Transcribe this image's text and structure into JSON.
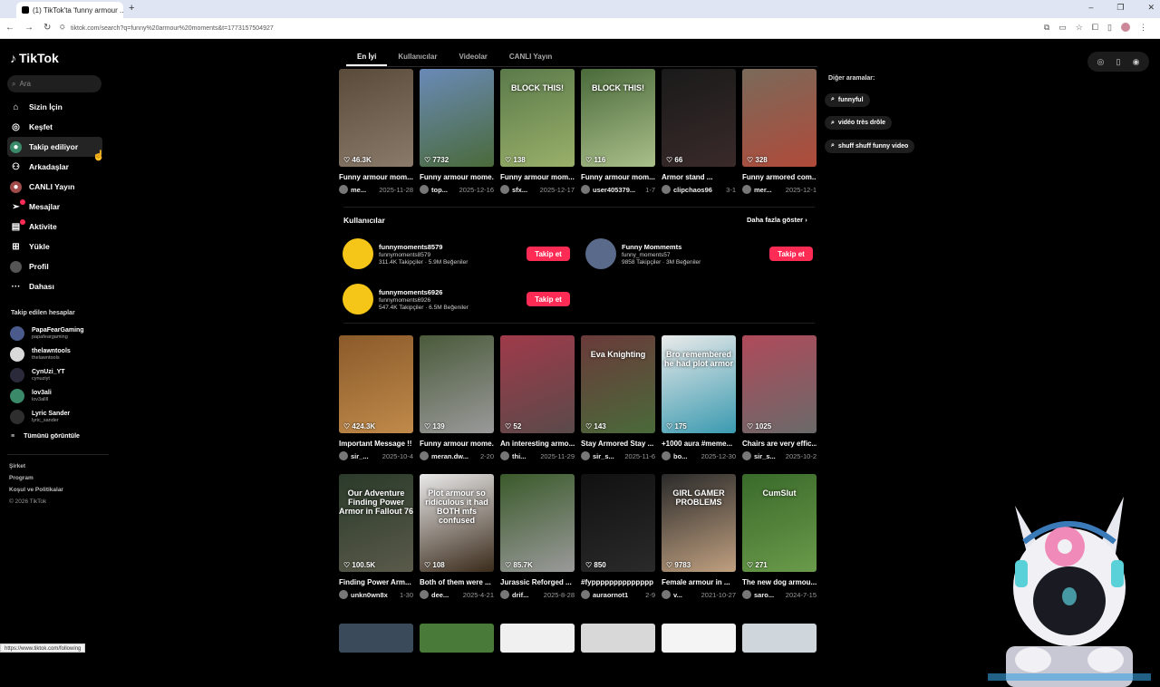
{
  "browser": {
    "tab_title": "(1) TikTok'ta 'funny armour ...",
    "tab_close": "✕",
    "url": "tiktok.com/search?q=funny%20armour%20moments&t=1773157504927",
    "status_url": "https://www.tiktok.com/following"
  },
  "brand": {
    "name": "TikTok"
  },
  "search": {
    "placeholder": "Ara"
  },
  "nav": [
    {
      "label": "Sizin İçin",
      "icon": "home-icon"
    },
    {
      "label": "Keşfet",
      "icon": "compass-icon"
    },
    {
      "label": "Takip ediliyor",
      "icon": "following-icon"
    },
    {
      "label": "Arkadaşlar",
      "icon": "friends-icon"
    },
    {
      "label": "CANLI Yayın",
      "icon": "live-icon"
    },
    {
      "label": "Mesajlar",
      "icon": "messages-icon"
    },
    {
      "label": "Aktivite",
      "icon": "activity-icon"
    },
    {
      "label": "Yükle",
      "icon": "upload-icon"
    },
    {
      "label": "Profil",
      "icon": "profile-icon"
    },
    {
      "label": "Dahası",
      "icon": "more-icon"
    }
  ],
  "following": {
    "title": "Takip edilen hesaplar",
    "accounts": [
      {
        "name": "PapaFearGaming",
        "handle": "papafeargaming",
        "color": "#4a5a8a"
      },
      {
        "name": "thelawntools",
        "handle": "thelawntools",
        "color": "#d9d9d9"
      },
      {
        "name": "CynUzi_YT",
        "handle": "cynuziyt",
        "color": "#2a2a3a"
      },
      {
        "name": "lov3ali",
        "handle": "lov3allll",
        "color": "#3a8a6a"
      },
      {
        "name": "Lyric Sander",
        "handle": "lyric_sander",
        "color": "#2e2e2e"
      }
    ],
    "see_all": "Tümünü görüntüle"
  },
  "footer": [
    "Şirket",
    "Program",
    "Koşul ve Politikalar",
    "© 2026 TikTok"
  ],
  "tabs": [
    "En İyi",
    "Kullanıcılar",
    "Videolar",
    "CANLI Yayın"
  ],
  "row1": [
    {
      "likes": "46.3K",
      "title": "Funny armour mom...",
      "user": "me...",
      "date": "2025-11-28",
      "c1": "#5a4a3a",
      "c2": "#8a7a6a",
      "overlay": ""
    },
    {
      "likes": "7732",
      "title": "Funny armour mome...",
      "user": "top...",
      "date": "2025-12-16",
      "c1": "#6a8ab8",
      "c2": "#4a6a3a",
      "overlay": ""
    },
    {
      "likes": "138",
      "title": "Funny armour mom...",
      "user": "sfx...",
      "date": "2025-12-17",
      "c1": "#5a7a4a",
      "c2": "#9ab06a",
      "overlay": "BLOCK THIS!"
    },
    {
      "likes": "116",
      "title": "Funny armour mom...",
      "user": "user405379...",
      "date": "1-7",
      "c1": "#4a6a3a",
      "c2": "#aabf8a",
      "overlay": "BLOCK THIS!"
    },
    {
      "likes": "66",
      "title": "Armor stand ...",
      "user": "clipchaos96",
      "date": "3-1",
      "c1": "#1a1a1a",
      "c2": "#3a2a2a",
      "overlay": ""
    },
    {
      "likes": "328",
      "title": "Funny armored com...",
      "user": "mer...",
      "date": "2025-12-1",
      "c1": "#7a6a5a",
      "c2": "#b04a3a",
      "overlay": ""
    }
  ],
  "users_section": {
    "title": "Kullanıcılar",
    "more": "Daha fazla göster",
    "users": [
      {
        "name": "funnymoments8579",
        "handle": "funnymoments8579",
        "followers": "311.4K Takipçiler",
        "likes": "5.9M Beğeniler",
        "follow": "Takip et",
        "color": "#f5c518"
      },
      {
        "name": "Funny Mommemts",
        "handle": "funny_moments57",
        "followers": "9858 Takipçiler",
        "likes": "3M Beğeniler",
        "follow": "Takip et",
        "color": "#5a6a8a"
      },
      {
        "name": "funnymoments6926",
        "handle": "funnymoments6926",
        "followers": "547.4K Takipçiler",
        "likes": "6.5M Beğeniler",
        "follow": "Takip et",
        "color": "#f5c518"
      }
    ]
  },
  "row2": [
    {
      "likes": "424.3K",
      "title": "Important Message !!",
      "user": "sir_...",
      "date": "2025-10-4",
      "c1": "#8a5a2a",
      "c2": "#c08a4a",
      "overlay": ""
    },
    {
      "likes": "139",
      "title": "Funny armour mome...",
      "user": "meran.dw...",
      "date": "2-20",
      "c1": "#4a5a3a",
      "c2": "#9a9a9a",
      "overlay": ""
    },
    {
      "likes": "52",
      "title": "An interesting armo...",
      "user": "thi...",
      "date": "2025-11-29",
      "c1": "#a03a4a",
      "c2": "#5a4a4a",
      "overlay": ""
    },
    {
      "likes": "143",
      "title": "Stay Armored Stay ...",
      "user": "sir_s...",
      "date": "2025-11-6",
      "c1": "#6a3a3a",
      "c2": "#4a6a3a",
      "overlay": "Eva Knighting"
    },
    {
      "likes": "175",
      "title": "+1000 aura #meme...",
      "user": "bo...",
      "date": "2025-12-30",
      "c1": "#eaeaea",
      "c2": "#3a9ab0",
      "overlay": "Bro remembered he had plot armor"
    },
    {
      "likes": "1025",
      "title": "Chairs are very effic...",
      "user": "sir_s...",
      "date": "2025-10-2",
      "c1": "#b04a5a",
      "c2": "#6a6a6a",
      "overlay": ""
    }
  ],
  "row3": [
    {
      "likes": "100.5K",
      "title": "Finding Power Arm...",
      "user": "unkn0wn8x",
      "date": "1-30",
      "c1": "#2a3a2a",
      "c2": "#5a5a4a",
      "overlay": "Our Adventure Finding Power Armor in Fallout 76"
    },
    {
      "likes": "108",
      "title": "Both of them were ...",
      "user": "dee...",
      "date": "2025-4-21",
      "c1": "#eaeaea",
      "c2": "#3a2a1a",
      "overlay": "Plot armour so ridiculous it had BOTH mfs confused"
    },
    {
      "likes": "85.7K",
      "title": "Jurassic Reforged ...",
      "user": "drif...",
      "date": "2025-8-28",
      "c1": "#3a5a2a",
      "c2": "#9a9a9a",
      "overlay": ""
    },
    {
      "likes": "850",
      "title": "#fypppppppppppppp",
      "user": "auraornot1",
      "date": "2-9",
      "c1": "#111111",
      "c2": "#2a2a2a",
      "overlay": ""
    },
    {
      "likes": "9783",
      "title": "Female armour in ...",
      "user": "v...",
      "date": "2021-10-27",
      "c1": "#2a2a2a",
      "c2": "#c0a080",
      "overlay": "GIRL GAMER PROBLEMS"
    },
    {
      "likes": "271",
      "title": "The new dog armou...",
      "user": "saro...",
      "date": "2024-7-15",
      "c1": "#3a6a2a",
      "c2": "#6a9a4a",
      "overlay": "CumSlut"
    }
  ],
  "related": {
    "title": "Diğer aramalar:",
    "items": [
      "funnyful",
      "vidéo très drôle",
      "shuff shuff funny video"
    ]
  },
  "accent": "#fe2c55"
}
